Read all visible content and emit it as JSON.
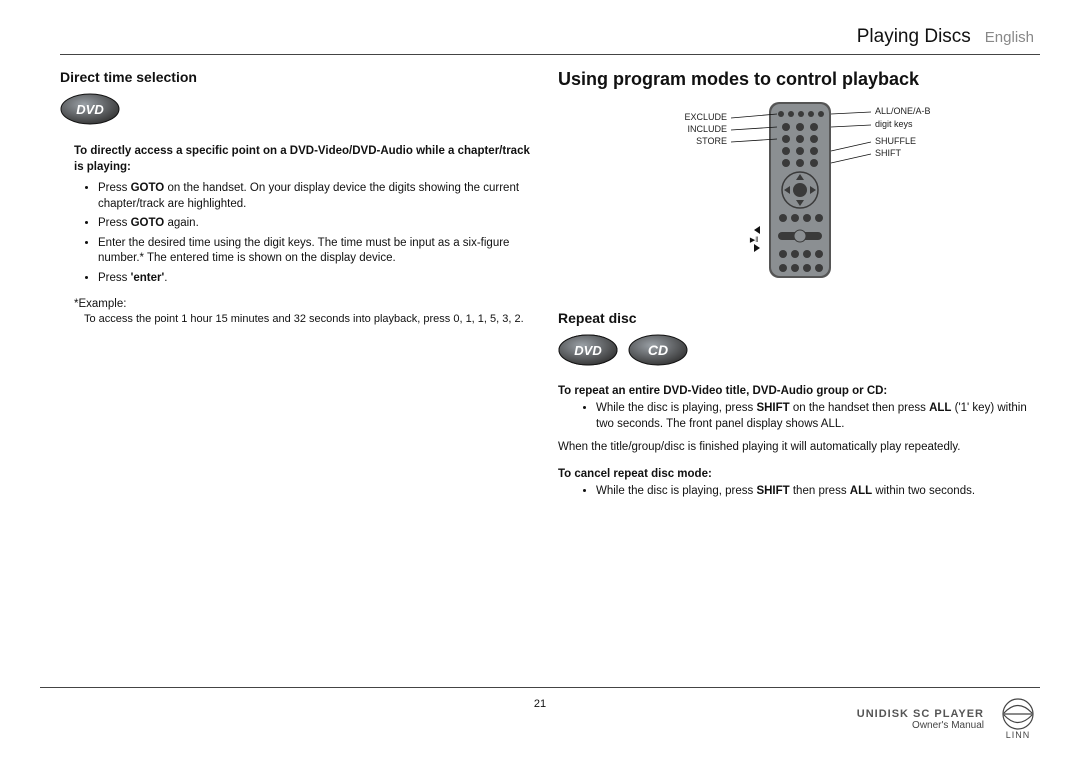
{
  "header": {
    "chapter": "Playing Discs",
    "language": "English"
  },
  "left": {
    "title": "Direct time selection",
    "lead": "To directly access a specific point on a DVD-Video/DVD-Audio while a chapter/track is playing:",
    "bullets": {
      "b1_pre": "Press ",
      "b1_bold": "GOTO",
      "b1_post": " on the handset. On your display device the digits showing the current chapter/track are highlighted.",
      "b2_pre": "Press ",
      "b2_bold": "GOTO",
      "b2_post": " again.",
      "b3": "Enter the desired time using the digit keys. The time must be input as a six-figure number.* The entered time is shown on the display device.",
      "b4_pre": "Press ",
      "b4_bold": "'enter'",
      "b4_post": "."
    },
    "example_label": "*Example:",
    "example_body": "To access the point 1 hour 15 minutes and 32 seconds into playback, press 0, 1, 1, 5, 3, 2."
  },
  "right": {
    "title": "Using program modes to control playback",
    "callouts": {
      "left": [
        "EXCLUDE",
        "INCLUDE",
        "STORE"
      ],
      "right": [
        "ALL/ONE/A-B",
        "digit keys",
        "SHUFFLE",
        "SHIFT"
      ]
    },
    "repeat": {
      "title": "Repeat disc",
      "lead": "To repeat an entire DVD-Video title, DVD-Audio group or CD:",
      "bullet_pre": "While the disc is playing, press ",
      "bullet_bold1": "SHIFT",
      "bullet_mid": " on the handset then press ",
      "bullet_bold2": "ALL",
      "bullet_post": " ('1' key) within two seconds. The front panel display shows ALL.",
      "after": "When the title/group/disc is finished playing it will automatically play repeatedly.",
      "cancel_lead": "To cancel repeat disc mode:",
      "cancel_bullet_pre": "While the disc is playing, press ",
      "cancel_bullet_bold1": "SHIFT",
      "cancel_bullet_mid": " then press ",
      "cancel_bullet_bold2": "ALL",
      "cancel_bullet_post": " within two seconds."
    }
  },
  "footer": {
    "page": "21",
    "product": "UNIDISK SC PLAYER",
    "ownman": "Owner's Manual",
    "brand": "LINN"
  }
}
